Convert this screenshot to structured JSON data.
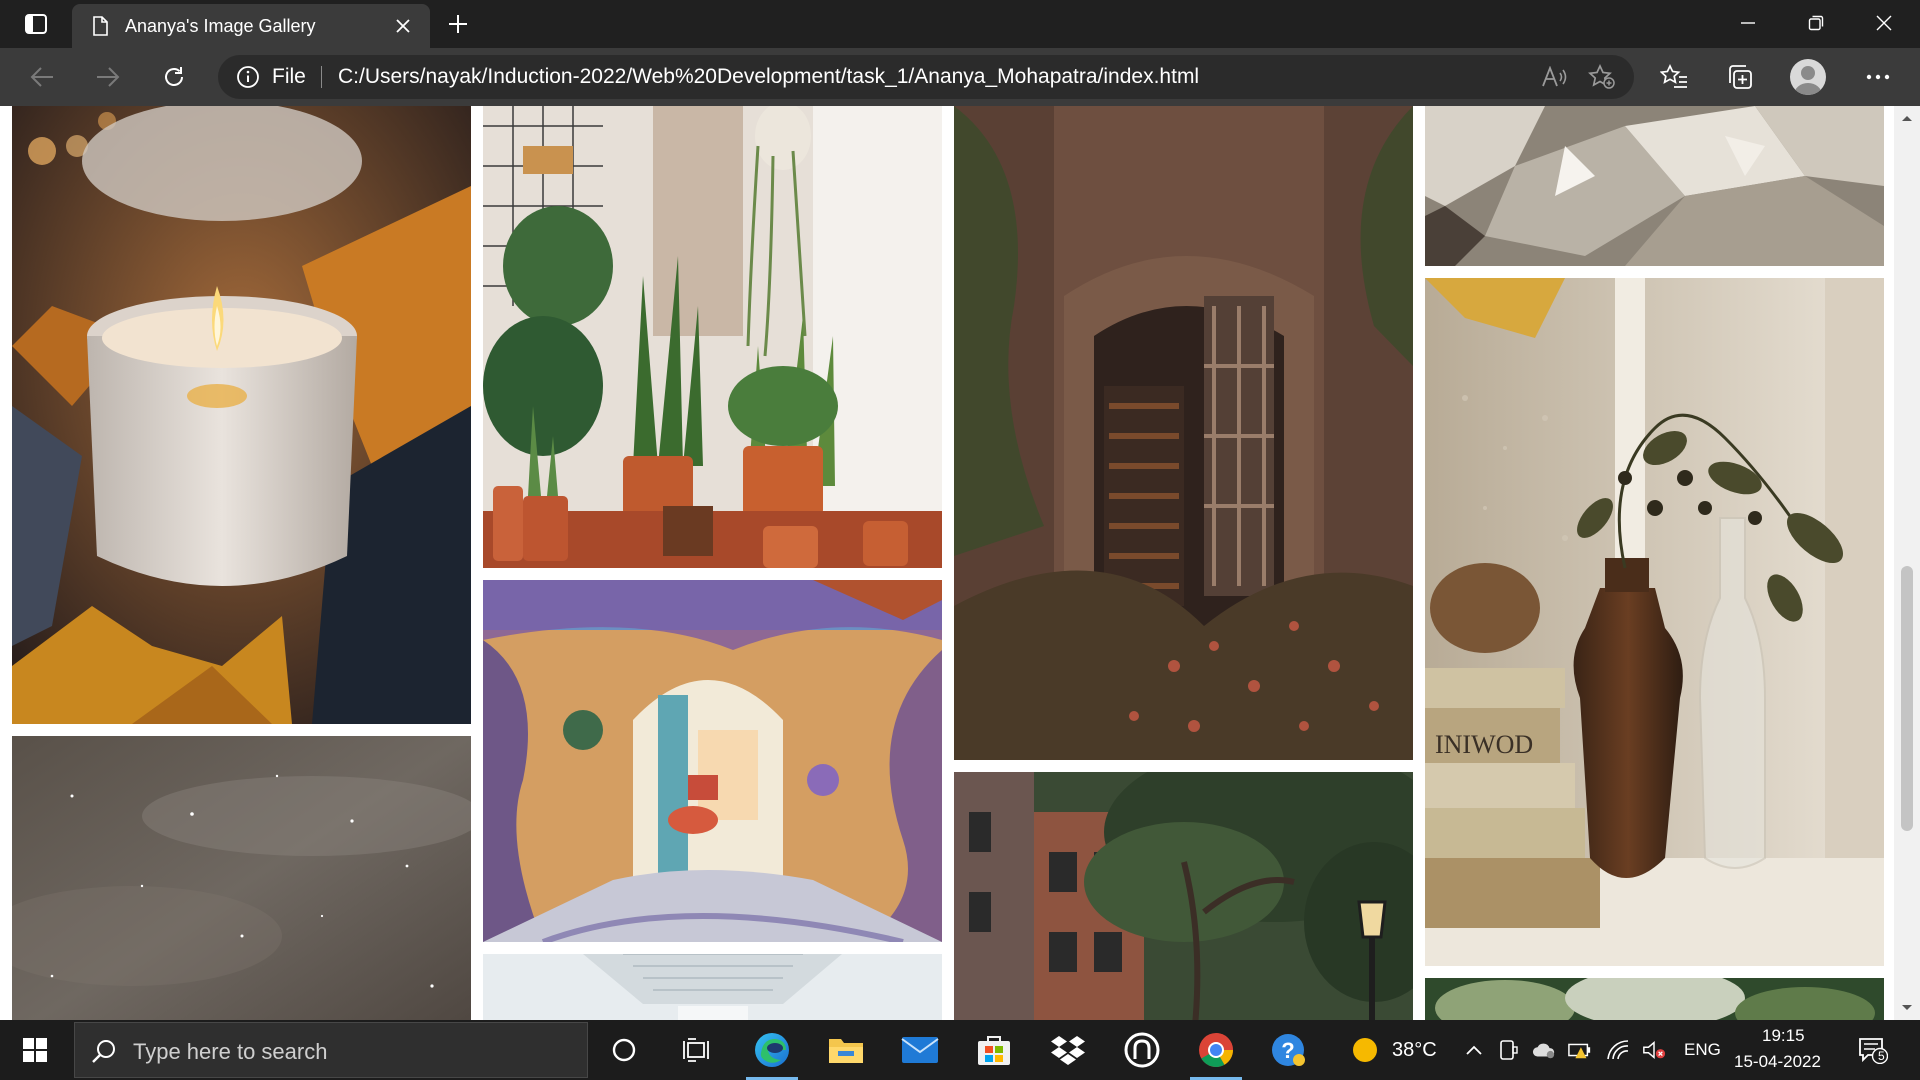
{
  "browser": {
    "tab_title": "Ananya's Image Gallery",
    "address": {
      "scheme_label": "File",
      "url": "C:/Users/nayak/Induction-2022/Web%20Development/task_1/Ananya_Mohapatra/index.html"
    }
  },
  "gallery": {
    "images": [
      {
        "subject": "candle with autumn leaves"
      },
      {
        "subject": "starry night sky"
      },
      {
        "subject": "potted plants corner"
      },
      {
        "subject": "painted flower archway"
      },
      {
        "subject": "white corridor"
      },
      {
        "subject": "ivy covered doorway with books"
      },
      {
        "subject": "street with trees and lamp"
      },
      {
        "subject": "crystal rock"
      },
      {
        "subject": "window sill with vases and books"
      },
      {
        "subject": "green leaves"
      }
    ]
  },
  "taskbar": {
    "search_placeholder": "Type here to search",
    "weather": "38°C",
    "language": "ENG",
    "time": "19:15",
    "date": "15-04-2022",
    "notification_count": "5"
  },
  "colors": {
    "tab_strip": "#202020",
    "toolbar": "#3b3b3b",
    "omnibox": "#2b2b2b",
    "taskbar": "#1c1c1c",
    "accent": "#76b9ed"
  }
}
